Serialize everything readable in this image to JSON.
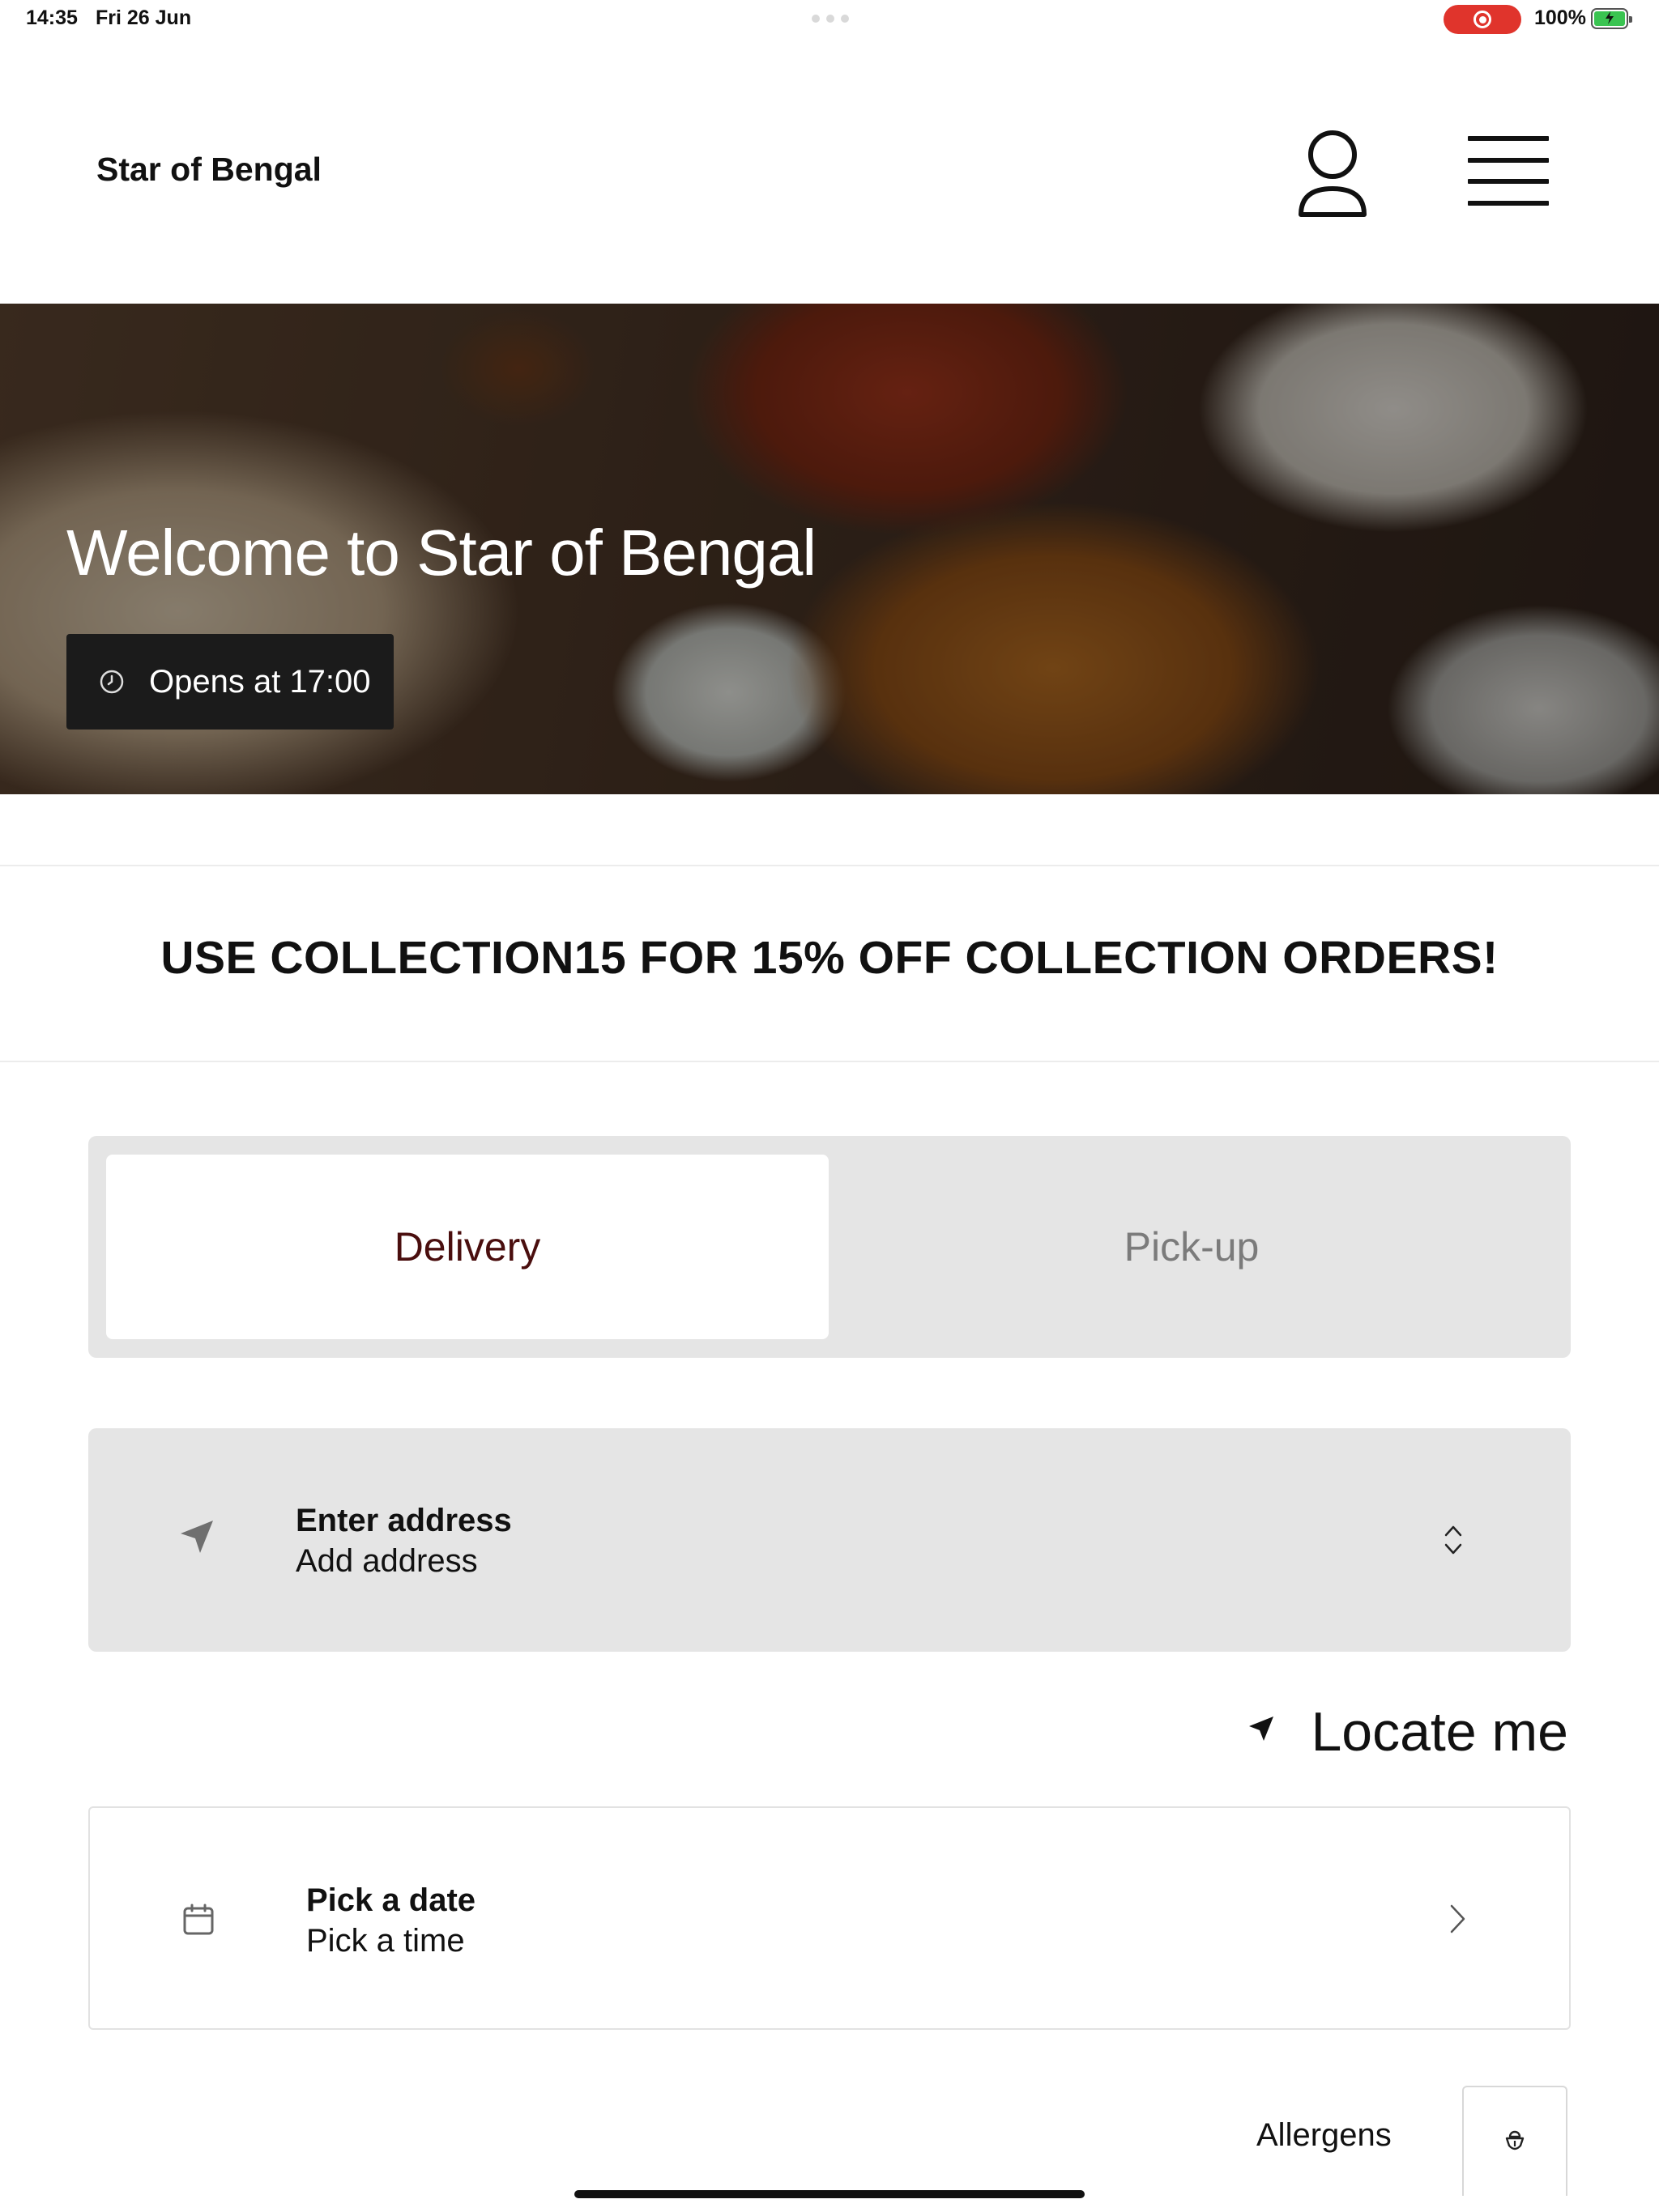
{
  "status_bar": {
    "time": "14:35",
    "date": "Fri 26 Jun",
    "battery": "100%",
    "recording_color": "#e0342c",
    "battery_color": "#3ac451"
  },
  "header": {
    "brand": "Star of Bengal",
    "account_icon": "user-icon",
    "menu_icon": "hamburger-menu-icon"
  },
  "hero": {
    "title": "Welcome to Star of Bengal",
    "hours_label": "Opens at 17:00",
    "hours_icon": "clock-icon"
  },
  "promo": {
    "text": "USE COLLECTION15 FOR 15% OFF COLLECTION ORDERS!"
  },
  "order_mode": {
    "options": [
      "Delivery",
      "Pick-up"
    ],
    "selected": "Delivery",
    "selected_color": "#4a0e0e"
  },
  "address": {
    "title": "Enter address",
    "subtitle": "Add address",
    "icon": "navigation-arrow-icon"
  },
  "locate": {
    "label": "Locate me",
    "icon": "location-arrow-icon"
  },
  "schedule": {
    "title": "Pick a date",
    "subtitle": "Pick a time",
    "icon": "calendar-icon"
  },
  "allergens": {
    "label": "Allergens",
    "icon": "allergen-icon"
  }
}
